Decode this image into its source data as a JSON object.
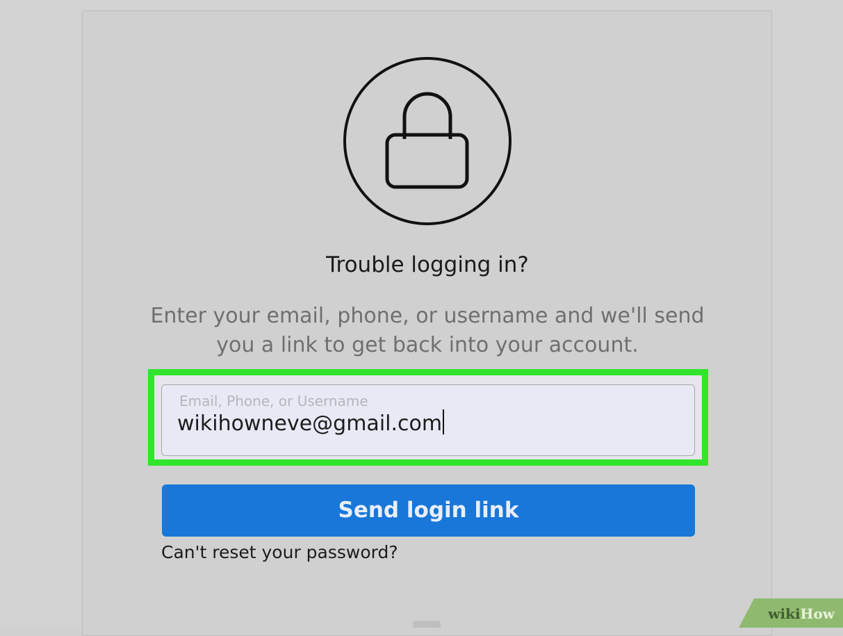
{
  "reset": {
    "title": "Trouble logging in?",
    "description": "Enter your email, phone, or username and we'll send you a link to get back into your account.",
    "field": {
      "label": "Email, Phone, or Username",
      "value": "wikihowneve@gmail.com"
    },
    "send_button": "Send login link",
    "cant_reset_link": "Can't reset your password?"
  },
  "watermark": {
    "wiki": "wiki",
    "how": "How"
  },
  "colors": {
    "accent_button": "#1877d8",
    "highlight": "#31e42c"
  },
  "icons": {
    "lock": "lock-icon"
  }
}
